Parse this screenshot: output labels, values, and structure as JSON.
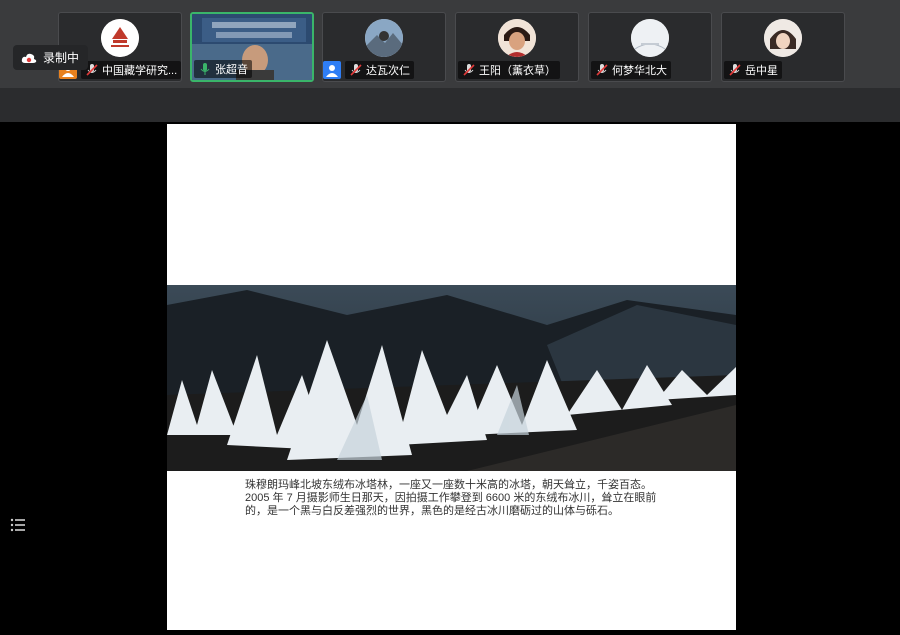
{
  "recording": {
    "label": "录制中"
  },
  "participants": [
    {
      "name": "中国藏学研究..."
    },
    {
      "name": "张超音"
    },
    {
      "name": "达瓦次仁"
    },
    {
      "name": "王阳（薰衣草）"
    },
    {
      "name": "何梦华北大"
    },
    {
      "name": "岳中星"
    }
  ],
  "slide": {
    "caption": "珠穆朗玛峰北坡东绒布冰塔林，一座又一座数十米高的冰塔，朝天耸立，千姿百态。2005 年 7 月摄影师生日那天，因拍摄工作攀登到 6600 米的东绒布冰川，耸立在眼前 的，是一个黑与白反差强烈的世界，黑色的是经古冰川磨砺过的山体与砾石。"
  },
  "colors": {
    "active_speaker": "#3ab56a",
    "mic_muted": "#e23a3a",
    "badge_orange": "#e8811e",
    "badge_blue": "#2f7ef5"
  }
}
